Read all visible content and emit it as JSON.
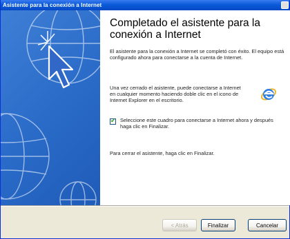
{
  "window": {
    "title": "Asistente para la conexión a Internet"
  },
  "heading": "Completado el asistente para la conexión a Internet",
  "paragraphs": {
    "p1": "El asistente para la conexión a Internet se completó con éxito. El equipo está configurado ahora para conectarse a la cuenta de Internet.",
    "p2": "Una vez cerrado el asistente, puede conectarse a Internet en cualquier momento haciendo doble clic en el icono de Internet Explorer en el escritorio.",
    "p3": "Para cerrar el asistente, haga clic en Finalizar."
  },
  "checkbox": {
    "checked": true,
    "mark": "✔",
    "label": "Seleccione este cuadro para conectarse a Internet ahora y después haga clic en Finalizar."
  },
  "buttons": {
    "back": "< Atrás",
    "finish": "Finalizar",
    "cancel": "Cancelar"
  },
  "icons": {
    "left_art": "globe-cursor-illustration",
    "ie": "internet-explorer-icon"
  }
}
